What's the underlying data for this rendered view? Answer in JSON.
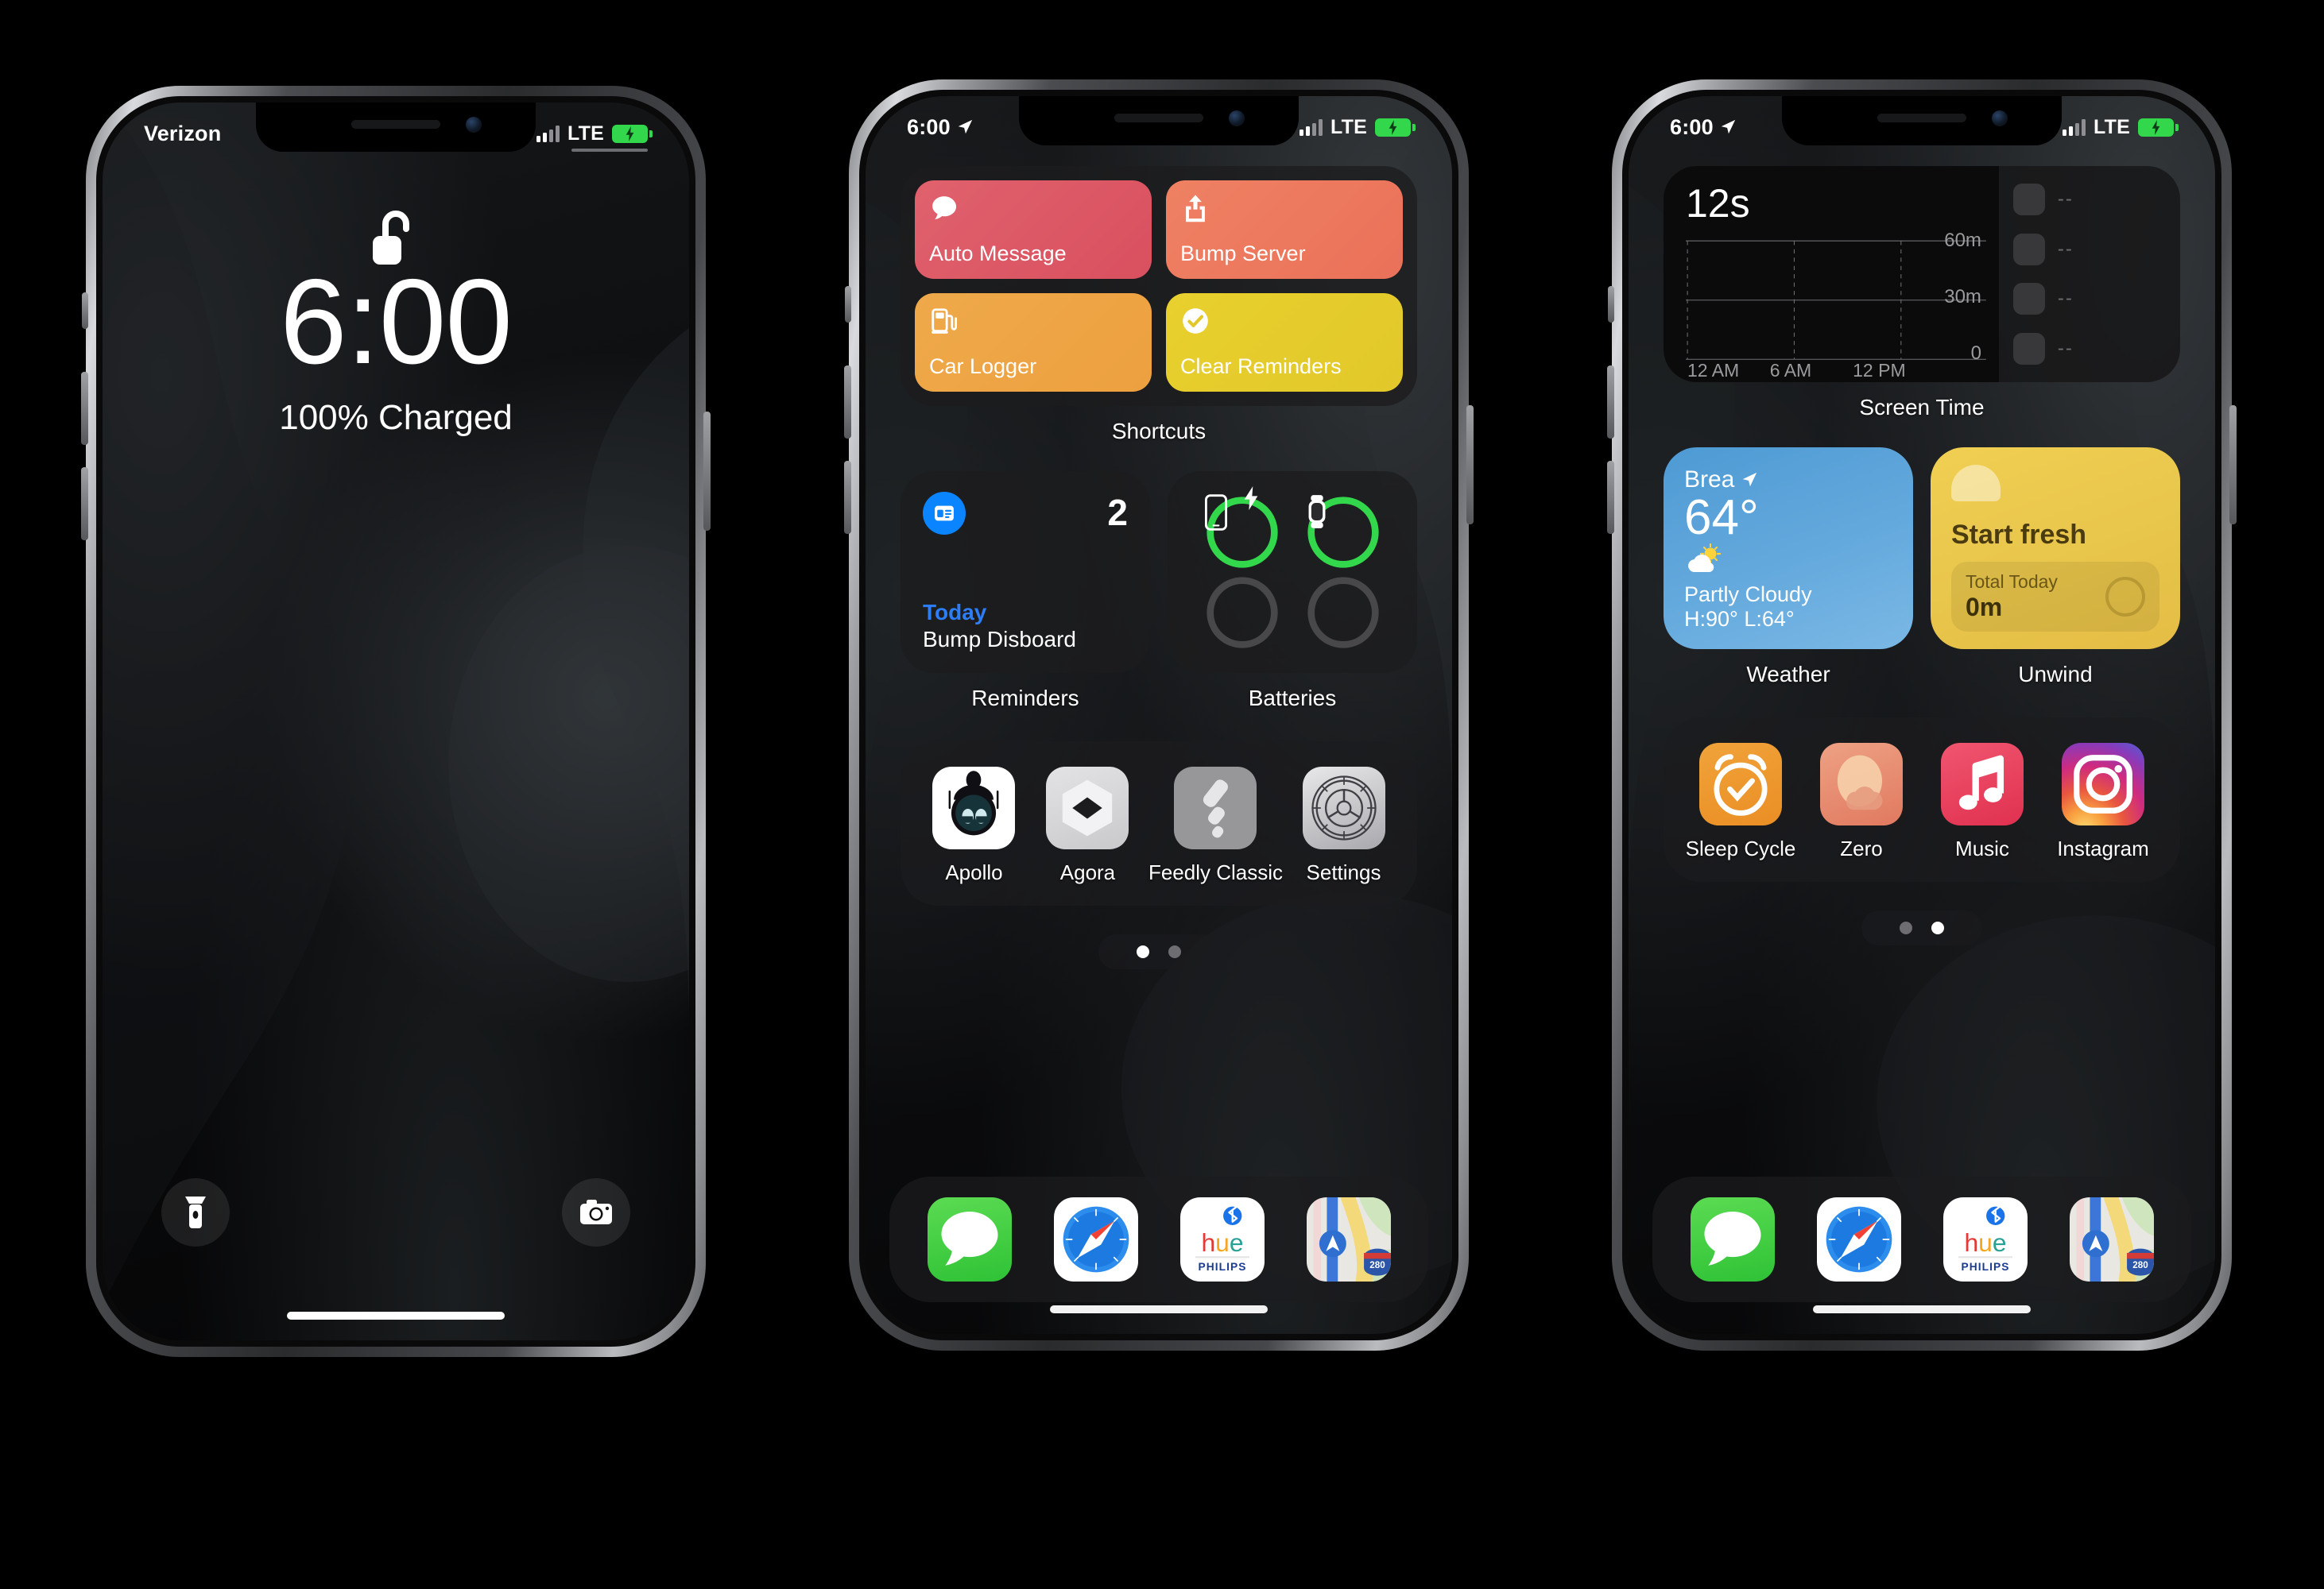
{
  "background_color": "#000000",
  "phones": [
    {
      "id": "lock-screen",
      "status": {
        "carrier": "Verizon",
        "network": "LTE",
        "battery_state": "charging"
      },
      "lock": {
        "lock_icon": "unlocked-padlock-icon",
        "time": "6:00",
        "charge_text": "100% Charged",
        "flashlight_icon": "flashlight-icon",
        "camera_icon": "camera-icon"
      }
    },
    {
      "id": "home-screen-page-1",
      "status": {
        "time": "6:00",
        "network": "LTE",
        "location_icon": "location-arrow-icon",
        "battery_state": "charging"
      },
      "widgets": [
        {
          "name": "Shortcuts",
          "type": "shortcuts",
          "tiles": [
            {
              "label": "Auto Message",
              "icon": "message-bubble-icon",
              "color": "#d9505f"
            },
            {
              "label": "Bump Server",
              "icon": "share-upload-icon",
              "color": "#ea7159"
            },
            {
              "label": "Car Logger",
              "icon": "fuel-pump-icon",
              "color": "#eda03f"
            },
            {
              "label": "Clear Reminders",
              "icon": "checkmark-circle-icon",
              "color": "#e2c82a"
            }
          ]
        },
        {
          "name": "Reminders",
          "type": "reminders",
          "badge_icon": "reminders-list-icon",
          "count": "2",
          "section": "Today",
          "task": "Bump Disboard"
        },
        {
          "name": "Batteries",
          "type": "batteries",
          "items": [
            {
              "device": "iphone-icon",
              "level": 100,
              "charging": true,
              "color": "#32d74b"
            },
            {
              "device": "watch-icon",
              "level": 100,
              "charging": false,
              "color": "#32d74b"
            },
            {
              "device": "empty-slot",
              "level": 0,
              "charging": false,
              "color": "#48484a"
            },
            {
              "device": "empty-slot",
              "level": 0,
              "charging": false,
              "color": "#48484a"
            }
          ]
        }
      ],
      "apps": [
        {
          "label": "Apollo",
          "icon": "apollo-robot-icon"
        },
        {
          "label": "Agora",
          "icon": "agora-hexagon-icon"
        },
        {
          "label": "Feedly Classic",
          "icon": "feedly-icon"
        },
        {
          "label": "Settings",
          "icon": "settings-gear-icon"
        }
      ],
      "page_dots": {
        "count": 2,
        "active": 0
      },
      "dock": [
        {
          "label": "Messages",
          "icon": "messages-icon"
        },
        {
          "label": "Safari",
          "icon": "safari-compass-icon"
        },
        {
          "label": "Philips Hue",
          "icon": "hue-icon",
          "brand": "PHILIPS",
          "wordmark": "hue"
        },
        {
          "label": "Maps",
          "icon": "maps-icon",
          "shield": "280"
        }
      ]
    },
    {
      "id": "home-screen-page-2",
      "status": {
        "time": "6:00",
        "network": "LTE",
        "location_icon": "location-arrow-icon",
        "battery_state": "charging"
      },
      "widgets": [
        {
          "name": "Screen Time",
          "type": "screen-time",
          "total": "12s",
          "app_rows": [
            "--",
            "--",
            "--",
            "--"
          ]
        },
        {
          "name": "Weather",
          "type": "weather",
          "city": "Brea",
          "location_icon": "location-arrow-icon",
          "temperature": "64°",
          "condition_icon": "partly-cloudy-icon",
          "condition": "Partly Cloudy",
          "high_low": "H:90° L:64°"
        },
        {
          "name": "Unwind",
          "type": "unwind",
          "title": "Start fresh",
          "total_label": "Total Today",
          "total_value": "0m"
        }
      ],
      "apps": [
        {
          "label": "Sleep Cycle",
          "icon": "alarm-clock-icon"
        },
        {
          "label": "Zero",
          "icon": "zero-fasting-icon"
        },
        {
          "label": "Music",
          "icon": "music-note-icon"
        },
        {
          "label": "Instagram",
          "icon": "instagram-camera-icon"
        }
      ],
      "page_dots": {
        "count": 2,
        "active": 1
      },
      "dock": [
        {
          "label": "Messages",
          "icon": "messages-icon"
        },
        {
          "label": "Safari",
          "icon": "safari-compass-icon"
        },
        {
          "label": "Philips Hue",
          "icon": "hue-icon",
          "brand": "PHILIPS",
          "wordmark": "hue"
        },
        {
          "label": "Maps",
          "icon": "maps-icon",
          "shield": "280"
        }
      ]
    }
  ],
  "chart_data": {
    "type": "bar",
    "title": "Screen Time",
    "total_label": "12s",
    "categories": [
      "12 AM",
      "6 AM",
      "12 PM"
    ],
    "values": [
      0,
      0,
      0
    ],
    "xlabel": "",
    "ylabel": "",
    "ylim": [
      0,
      60
    ],
    "yticks": [
      "0",
      "30m",
      "60m"
    ],
    "xticks": [
      "12 AM",
      "6 AM",
      "12 PM"
    ],
    "grid": true,
    "legend": "none"
  }
}
